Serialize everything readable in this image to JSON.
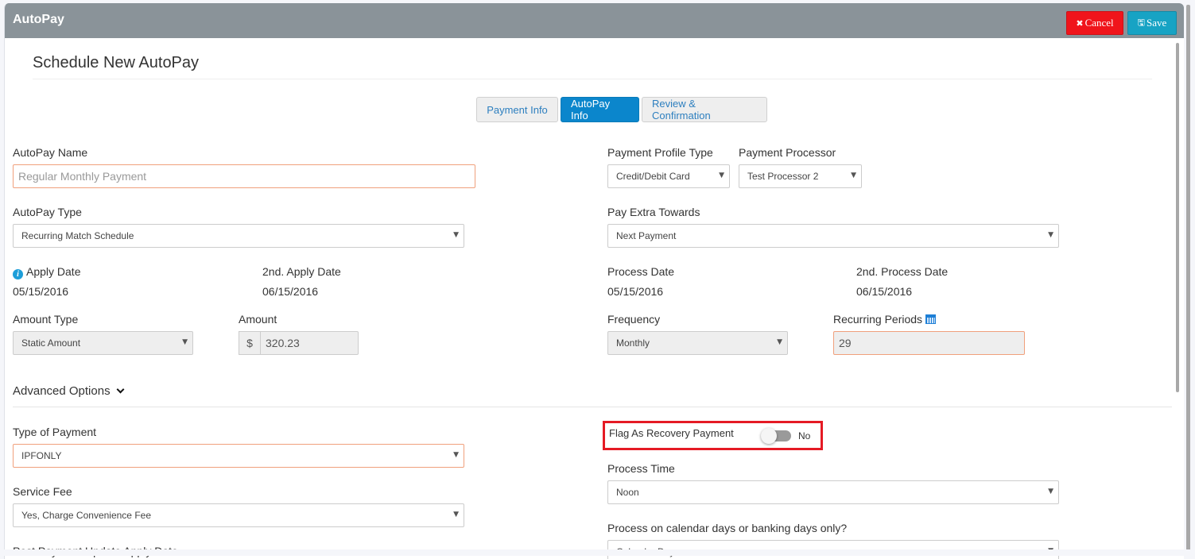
{
  "header": {
    "title": "AutoPay",
    "cancel_label": "Cancel",
    "save_label": "Save",
    "cancel_icon": "close-icon",
    "save_icon": "floppy-disk-icon",
    "cancel_color": "#f0141b",
    "save_color": "#17a3c4"
  },
  "page_title": "Schedule New AutoPay",
  "tabs": [
    {
      "label": "Payment Info",
      "active": false
    },
    {
      "label": "AutoPay Info",
      "active": true
    },
    {
      "label": "Review & Confirmation",
      "active": false
    }
  ],
  "form": {
    "autopay_name": {
      "label": "AutoPay Name",
      "placeholder": "Regular Monthly Payment",
      "value": ""
    },
    "autopay_type": {
      "label": "AutoPay Type",
      "value": "Recurring Match Schedule"
    },
    "payment_profile_type": {
      "label": "Payment Profile Type",
      "value": "Credit/Debit Card"
    },
    "payment_processor": {
      "label": "Payment Processor",
      "value": "Test Processor 2"
    },
    "pay_extra_towards": {
      "label": "Pay Extra Towards",
      "value": "Next Payment"
    },
    "apply_date": {
      "label": "Apply Date",
      "value": "05/15/2016",
      "icon": "info-icon"
    },
    "second_apply_date": {
      "label": "2nd. Apply Date",
      "value": "06/15/2016"
    },
    "process_date": {
      "label": "Process Date",
      "value": "05/15/2016"
    },
    "second_process_date": {
      "label": "2nd. Process Date",
      "value": "06/15/2016"
    },
    "amount_type": {
      "label": "Amount Type",
      "value": "Static Amount"
    },
    "amount": {
      "label": "Amount",
      "currency": "$",
      "value": "320.23"
    },
    "frequency": {
      "label": "Frequency",
      "value": "Monthly"
    },
    "recurring_periods": {
      "label": "Recurring Periods",
      "value": "29",
      "icon": "calendar-icon"
    }
  },
  "advanced": {
    "toggle_label": "Advanced Options",
    "type_of_payment": {
      "label": "Type of Payment",
      "value": "IPFONLY"
    },
    "service_fee": {
      "label": "Service Fee",
      "value": "Yes, Charge Convenience Fee"
    },
    "post_payment_label": "Post Payment Update Apply Date",
    "flag_recovery": {
      "label": "Flag As Recovery Payment",
      "state": "No",
      "checked": false,
      "highlight_color": "#e51a24"
    },
    "process_time": {
      "label": "Process Time",
      "value": "Noon"
    },
    "process_days": {
      "label": "Process on calendar days or banking days only?",
      "value": "Calendar Days"
    }
  }
}
